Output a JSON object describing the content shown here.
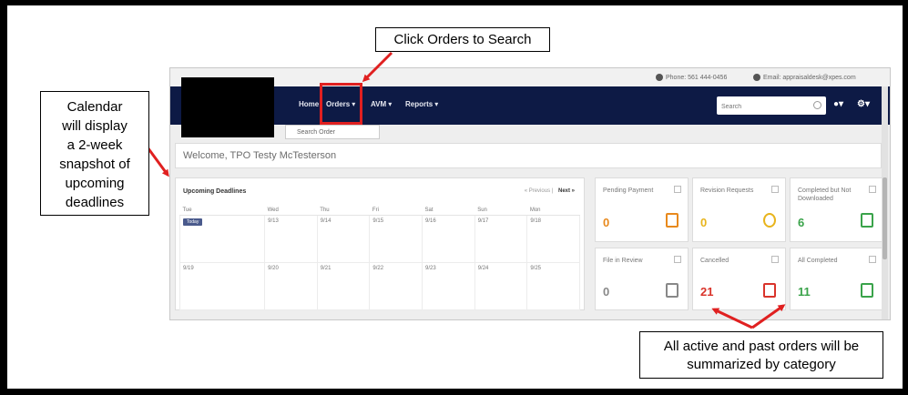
{
  "callouts": {
    "orders": "Click Orders to Search",
    "calendar": [
      "Calendar",
      "will display",
      "a 2-week",
      "snapshot of",
      "upcoming",
      "deadlines"
    ],
    "summary": [
      "All active and past orders will be",
      "summarized by category"
    ]
  },
  "topbar": {
    "phone": "Phone: 561 444-0456",
    "email": "Email: appraisaldesk@xpes.com"
  },
  "nav": {
    "items": [
      {
        "label": "Home",
        "caret": ""
      },
      {
        "label": "Orders",
        "caret": "▾"
      },
      {
        "label": "AVM",
        "caret": "▾"
      },
      {
        "label": "Reports",
        "caret": "▾"
      }
    ],
    "search_placeholder": "Search",
    "help_icon": "●▾",
    "settings_icon": "⚙▾"
  },
  "dropdown": {
    "item": "Search Order"
  },
  "welcome": "Welcome, TPO Testy McTesterson",
  "calendar": {
    "title": "Upcoming Deadlines",
    "prev": "« Previous",
    "sep": "|",
    "next": "Next »",
    "days": [
      "Tue",
      "Wed",
      "Thu",
      "Fri",
      "Sat",
      "Sun",
      "Mon"
    ],
    "weeks": [
      [
        "Today",
        "9/13",
        "9/14",
        "9/15",
        "9/16",
        "9/17",
        "9/18"
      ],
      [
        "9/19",
        "9/20",
        "9/21",
        "9/22",
        "9/23",
        "9/24",
        "9/25"
      ]
    ]
  },
  "cards": [
    {
      "label": "Pending Payment",
      "count": "0",
      "color": "#e8891c",
      "icon": "payment-icon"
    },
    {
      "label": "Revision Requests",
      "count": "0",
      "color": "#e8b41c",
      "icon": "revision-icon"
    },
    {
      "label": "Completed but Not Downloaded",
      "count": "6",
      "color": "#3aa34a",
      "icon": "download-icon"
    },
    {
      "label": "File in Review",
      "count": "0",
      "color": "#888888",
      "icon": "review-icon"
    },
    {
      "label": "Cancelled",
      "count": "21",
      "color": "#d9342b",
      "icon": "cancelled-icon"
    },
    {
      "label": "All Completed",
      "count": "11",
      "color": "#3aa34a",
      "icon": "completed-icon"
    }
  ]
}
